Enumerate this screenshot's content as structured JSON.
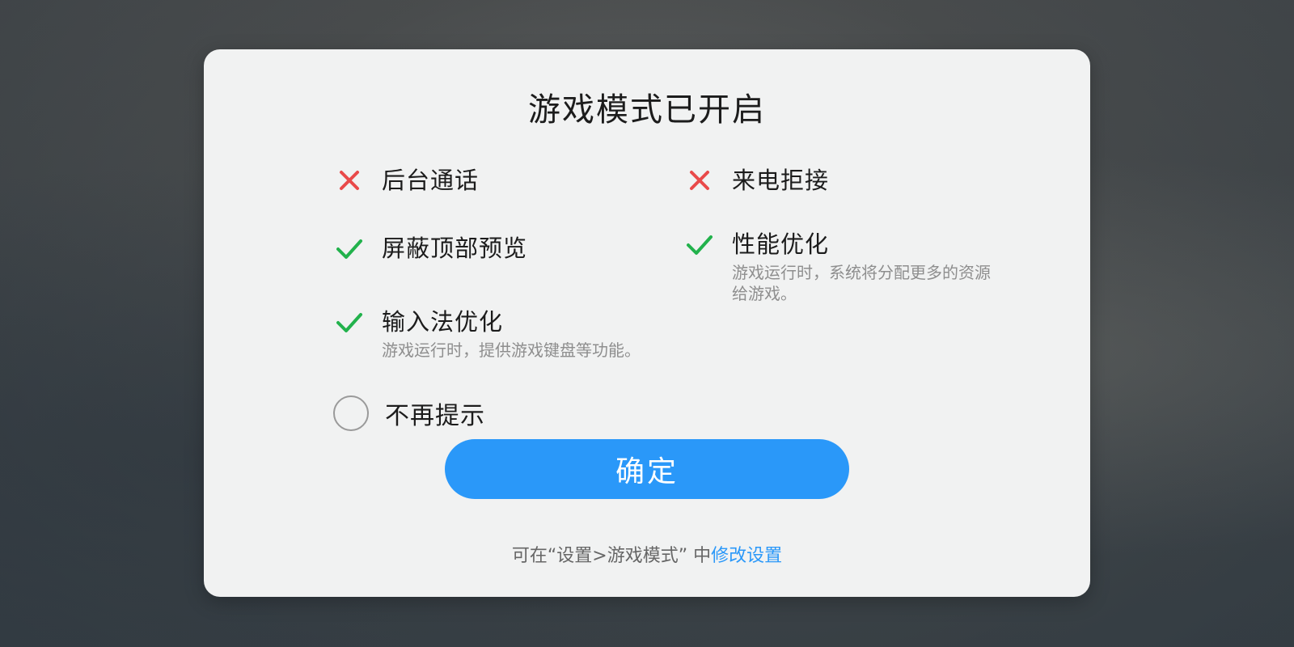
{
  "dialog": {
    "title": "游戏模式已开启",
    "features": {
      "background_call": {
        "label": "后台通话",
        "enabled": false
      },
      "call_reject": {
        "label": "来电拒接",
        "enabled": false
      },
      "top_preview": {
        "label": "屏蔽顶部预览",
        "enabled": true
      },
      "performance": {
        "label": "性能优化",
        "enabled": true,
        "desc": "游戏运行时，系统将分配更多的资源给游戏。"
      },
      "ime": {
        "label": "输入法优化",
        "enabled": true,
        "desc": "游戏运行时，提供游戏键盘等功能。"
      }
    },
    "no_remind": {
      "label": "不再提示",
      "checked": false
    },
    "confirm_label": "确定",
    "footer": {
      "prefix": "可在“设置>游戏模式” 中",
      "link": "修改设置"
    }
  },
  "colors": {
    "accent": "#2a98f9",
    "check": "#22b24c",
    "cross": "#e94a4a"
  },
  "icons": {
    "enabled": "check-icon",
    "disabled": "cross-icon"
  }
}
